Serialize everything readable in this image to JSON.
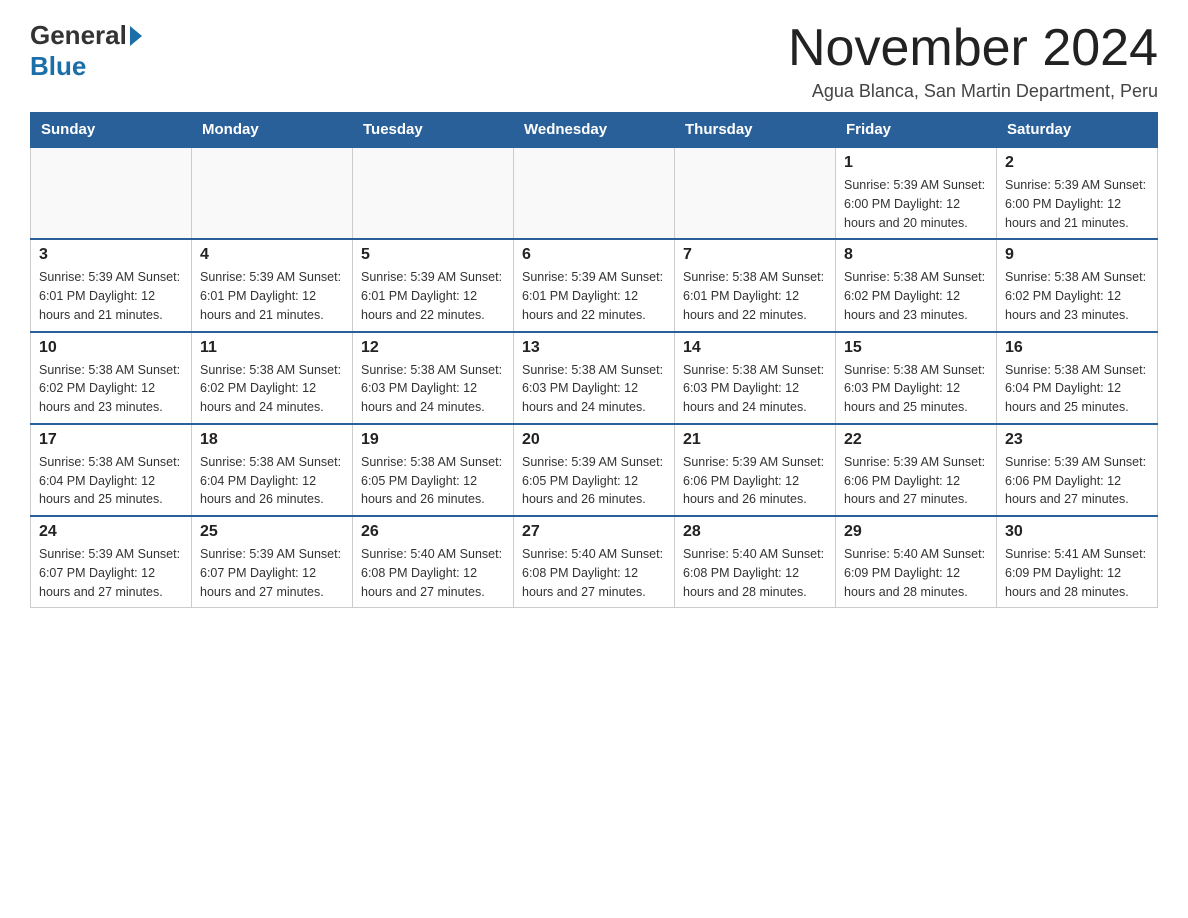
{
  "header": {
    "logo_general": "General",
    "logo_blue": "Blue",
    "title": "November 2024",
    "subtitle": "Agua Blanca, San Martin Department, Peru"
  },
  "days_of_week": [
    "Sunday",
    "Monday",
    "Tuesday",
    "Wednesday",
    "Thursday",
    "Friday",
    "Saturday"
  ],
  "weeks": [
    [
      {
        "day": "",
        "info": ""
      },
      {
        "day": "",
        "info": ""
      },
      {
        "day": "",
        "info": ""
      },
      {
        "day": "",
        "info": ""
      },
      {
        "day": "",
        "info": ""
      },
      {
        "day": "1",
        "info": "Sunrise: 5:39 AM\nSunset: 6:00 PM\nDaylight: 12 hours and 20 minutes."
      },
      {
        "day": "2",
        "info": "Sunrise: 5:39 AM\nSunset: 6:00 PM\nDaylight: 12 hours and 21 minutes."
      }
    ],
    [
      {
        "day": "3",
        "info": "Sunrise: 5:39 AM\nSunset: 6:01 PM\nDaylight: 12 hours and 21 minutes."
      },
      {
        "day": "4",
        "info": "Sunrise: 5:39 AM\nSunset: 6:01 PM\nDaylight: 12 hours and 21 minutes."
      },
      {
        "day": "5",
        "info": "Sunrise: 5:39 AM\nSunset: 6:01 PM\nDaylight: 12 hours and 22 minutes."
      },
      {
        "day": "6",
        "info": "Sunrise: 5:39 AM\nSunset: 6:01 PM\nDaylight: 12 hours and 22 minutes."
      },
      {
        "day": "7",
        "info": "Sunrise: 5:38 AM\nSunset: 6:01 PM\nDaylight: 12 hours and 22 minutes."
      },
      {
        "day": "8",
        "info": "Sunrise: 5:38 AM\nSunset: 6:02 PM\nDaylight: 12 hours and 23 minutes."
      },
      {
        "day": "9",
        "info": "Sunrise: 5:38 AM\nSunset: 6:02 PM\nDaylight: 12 hours and 23 minutes."
      }
    ],
    [
      {
        "day": "10",
        "info": "Sunrise: 5:38 AM\nSunset: 6:02 PM\nDaylight: 12 hours and 23 minutes."
      },
      {
        "day": "11",
        "info": "Sunrise: 5:38 AM\nSunset: 6:02 PM\nDaylight: 12 hours and 24 minutes."
      },
      {
        "day": "12",
        "info": "Sunrise: 5:38 AM\nSunset: 6:03 PM\nDaylight: 12 hours and 24 minutes."
      },
      {
        "day": "13",
        "info": "Sunrise: 5:38 AM\nSunset: 6:03 PM\nDaylight: 12 hours and 24 minutes."
      },
      {
        "day": "14",
        "info": "Sunrise: 5:38 AM\nSunset: 6:03 PM\nDaylight: 12 hours and 24 minutes."
      },
      {
        "day": "15",
        "info": "Sunrise: 5:38 AM\nSunset: 6:03 PM\nDaylight: 12 hours and 25 minutes."
      },
      {
        "day": "16",
        "info": "Sunrise: 5:38 AM\nSunset: 6:04 PM\nDaylight: 12 hours and 25 minutes."
      }
    ],
    [
      {
        "day": "17",
        "info": "Sunrise: 5:38 AM\nSunset: 6:04 PM\nDaylight: 12 hours and 25 minutes."
      },
      {
        "day": "18",
        "info": "Sunrise: 5:38 AM\nSunset: 6:04 PM\nDaylight: 12 hours and 26 minutes."
      },
      {
        "day": "19",
        "info": "Sunrise: 5:38 AM\nSunset: 6:05 PM\nDaylight: 12 hours and 26 minutes."
      },
      {
        "day": "20",
        "info": "Sunrise: 5:39 AM\nSunset: 6:05 PM\nDaylight: 12 hours and 26 minutes."
      },
      {
        "day": "21",
        "info": "Sunrise: 5:39 AM\nSunset: 6:06 PM\nDaylight: 12 hours and 26 minutes."
      },
      {
        "day": "22",
        "info": "Sunrise: 5:39 AM\nSunset: 6:06 PM\nDaylight: 12 hours and 27 minutes."
      },
      {
        "day": "23",
        "info": "Sunrise: 5:39 AM\nSunset: 6:06 PM\nDaylight: 12 hours and 27 minutes."
      }
    ],
    [
      {
        "day": "24",
        "info": "Sunrise: 5:39 AM\nSunset: 6:07 PM\nDaylight: 12 hours and 27 minutes."
      },
      {
        "day": "25",
        "info": "Sunrise: 5:39 AM\nSunset: 6:07 PM\nDaylight: 12 hours and 27 minutes."
      },
      {
        "day": "26",
        "info": "Sunrise: 5:40 AM\nSunset: 6:08 PM\nDaylight: 12 hours and 27 minutes."
      },
      {
        "day": "27",
        "info": "Sunrise: 5:40 AM\nSunset: 6:08 PM\nDaylight: 12 hours and 27 minutes."
      },
      {
        "day": "28",
        "info": "Sunrise: 5:40 AM\nSunset: 6:08 PM\nDaylight: 12 hours and 28 minutes."
      },
      {
        "day": "29",
        "info": "Sunrise: 5:40 AM\nSunset: 6:09 PM\nDaylight: 12 hours and 28 minutes."
      },
      {
        "day": "30",
        "info": "Sunrise: 5:41 AM\nSunset: 6:09 PM\nDaylight: 12 hours and 28 minutes."
      }
    ]
  ]
}
